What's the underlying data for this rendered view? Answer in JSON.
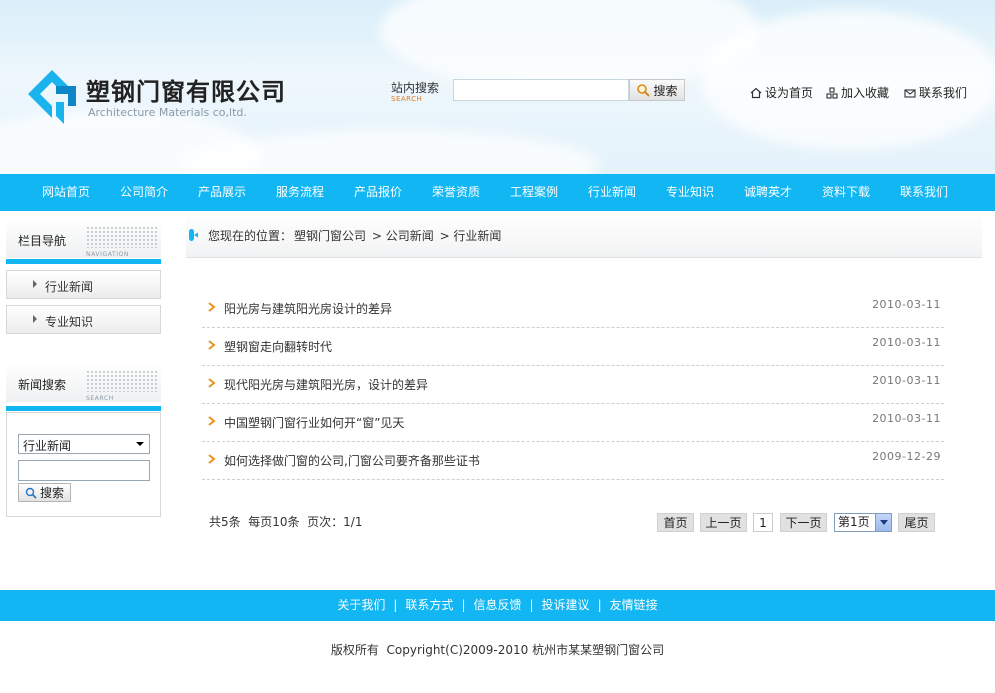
{
  "header": {
    "company_name": "塑钢门窗有限公司",
    "company_name_en": "Architecture Materials co,ltd.",
    "search_label": "站内搜索",
    "search_label_en": "SEARCH",
    "search_placeholder": "",
    "search_button": "搜索",
    "links": [
      {
        "label": "设为首页",
        "icon": "home-icon"
      },
      {
        "label": "加入收藏",
        "icon": "favorites-icon"
      },
      {
        "label": "联系我们",
        "icon": "mail-icon"
      }
    ]
  },
  "nav": {
    "items": [
      "网站首页",
      "公司简介",
      "产品展示",
      "服务流程",
      "产品报价",
      "荣誉资质",
      "工程案例",
      "行业新闻",
      "专业知识",
      "诚聘英才",
      "资料下载",
      "联系我们"
    ]
  },
  "sidebar": {
    "navigation_title": "栏目导航",
    "navigation_title_en": "NAVIGATION",
    "items": [
      "行业新闻",
      "专业知识"
    ],
    "search_title": "新闻搜索",
    "search_title_en": "SEARCH",
    "search_category": "行业新闻",
    "search_button": "搜索"
  },
  "breadcrumb": {
    "prefix": "您现在的位置：",
    "home": "塑钢门窗公司",
    "level1": "> 公司新闻",
    "level2": "> 行业新闻"
  },
  "news": [
    {
      "title": "阳光房与建筑阳光房设计的差异",
      "date": "2010-03-11"
    },
    {
      "title": "塑钢窗走向翻转时代",
      "date": "2010-03-11"
    },
    {
      "title": "现代阳光房与建筑阳光房，设计的差异",
      "date": "2010-03-11"
    },
    {
      "title": "中国塑钢门窗行业如何开“窗”见天",
      "date": "2010-03-11"
    },
    {
      "title": "如何选择做门窗的公司,门窗公司要齐备那些证书",
      "date": "2009-12-29"
    }
  ],
  "pagination": {
    "summary": "共5条  每页10条  页次：1/1",
    "first": "首页",
    "prev": "上一页",
    "current": "1",
    "next": "下一页",
    "select_value": "第1页",
    "last": "尾页"
  },
  "footer": {
    "links": [
      "关于我们",
      "联系方式",
      "信息反馈",
      "投诉建议",
      "友情链接"
    ],
    "separator": "|",
    "copyright": "版权所有  Copyright(C)2009-2010 杭州市某某塑钢门窗公司"
  },
  "colors": {
    "accent": "#12b6f2",
    "bullet": "#e8931e"
  }
}
